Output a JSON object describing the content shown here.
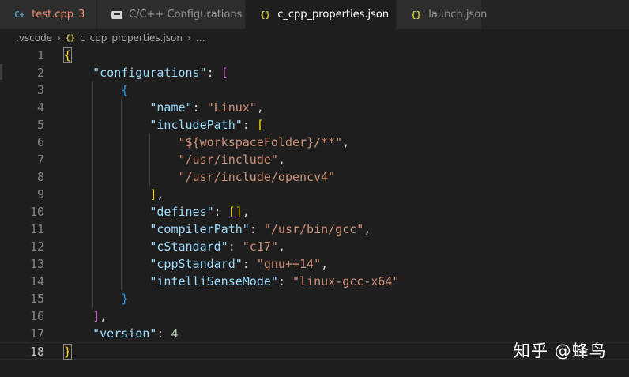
{
  "tabs": [
    {
      "label": "test.cpp",
      "icon": "cpp-file-icon",
      "badge": "3"
    },
    {
      "label": "C/C++ Configurations",
      "icon": "settings-file-icon"
    },
    {
      "label": "c_cpp_properties.json",
      "icon": "json-file-icon",
      "modified": true
    },
    {
      "label": "launch.json",
      "icon": "json-file-icon"
    }
  ],
  "breadcrumb": {
    "folder": ".vscode",
    "file": "c_cpp_properties.json",
    "more": "…",
    "icon_glyph": "{}"
  },
  "editor": {
    "language": "json",
    "current_line": "18",
    "lines": [
      {
        "n": "1",
        "text": "{"
      },
      {
        "n": "2",
        "text": "    \"configurations\": ["
      },
      {
        "n": "3",
        "text": "        {"
      },
      {
        "n": "4",
        "text": "            \"name\": \"Linux\","
      },
      {
        "n": "5",
        "text": "            \"includePath\": ["
      },
      {
        "n": "6",
        "text": "                \"${workspaceFolder}/**\","
      },
      {
        "n": "7",
        "text": "                \"/usr/include\","
      },
      {
        "n": "8",
        "text": "                \"/usr/include/opencv4\""
      },
      {
        "n": "9",
        "text": "            ],"
      },
      {
        "n": "10",
        "text": "            \"defines\": [],"
      },
      {
        "n": "11",
        "text": "            \"compilerPath\": \"/usr/bin/gcc\","
      },
      {
        "n": "12",
        "text": "            \"cStandard\": \"c17\","
      },
      {
        "n": "13",
        "text": "            \"cppStandard\": \"gnu++14\","
      },
      {
        "n": "14",
        "text": "            \"intelliSenseMode\": \"linux-gcc-x64\""
      },
      {
        "n": "15",
        "text": "        }"
      },
      {
        "n": "16",
        "text": "    ],"
      },
      {
        "n": "17",
        "text": "    \"version\": 4"
      },
      {
        "n": "18",
        "text": "}"
      }
    ]
  },
  "watermark": "知乎 @蜂鸟",
  "colors": {
    "background": "#1e1e1e",
    "tab_inactive": "#2d2d2d",
    "key": "#9cdcfe",
    "string": "#ce9178",
    "number": "#b5cea8",
    "bracket_level1": "#ffd700",
    "bracket_level2": "#da70d6",
    "bracket_level3": "#179fff",
    "error": "#f48771"
  }
}
